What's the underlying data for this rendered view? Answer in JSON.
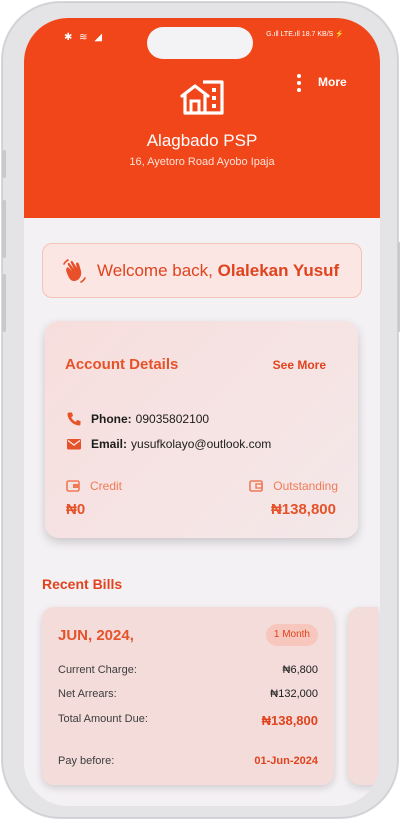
{
  "status_bar": {
    "left_icons": "✱ ≋ ◢",
    "right_text": "G.ıll LTE.ıll 18.7 KB/S ⚡"
  },
  "header": {
    "more_label": "More",
    "shop_name": "Alagbado PSP",
    "shop_address": "16, Ayetoro Road Ayobo Ipaja"
  },
  "welcome": {
    "prefix": "Welcome back, ",
    "name": "Olalekan Yusuf"
  },
  "account": {
    "title": "Account Details",
    "see_more": "See More",
    "phone_label": "Phone:",
    "phone_value": "09035802100",
    "email_label": "Email:",
    "email_value": "yusufkolayo@outlook.com",
    "credit_label": "Credit",
    "credit_value": "₦0",
    "outstanding_label": "Outstanding",
    "outstanding_value": "₦138,800"
  },
  "recent_bills": {
    "title": "Recent Bills",
    "bills": [
      {
        "period": "JUN, 2024,",
        "badge": "1 Month",
        "current_charge_label": "Current Charge:",
        "current_charge_value": "₦6,800",
        "net_arrears_label": "Net Arrears:",
        "net_arrears_value": "₦132,000",
        "total_due_label": "Total Amount Due:",
        "total_due_value": "₦138,800",
        "pay_before_label": "Pay before:",
        "pay_before_value": "01-Jun-2024"
      }
    ]
  },
  "colors": {
    "brand": "#f1461a",
    "accent_text": "#e0431e",
    "card_bg": "#f3dcda"
  },
  "icons": [
    "bluetooth-icon",
    "wifi-icon",
    "signal-icon",
    "battery-charging-icon",
    "more-vertical-icon",
    "building-logo-icon",
    "waving-hand-icon",
    "phone-icon",
    "email-icon",
    "wallet-icon"
  ]
}
